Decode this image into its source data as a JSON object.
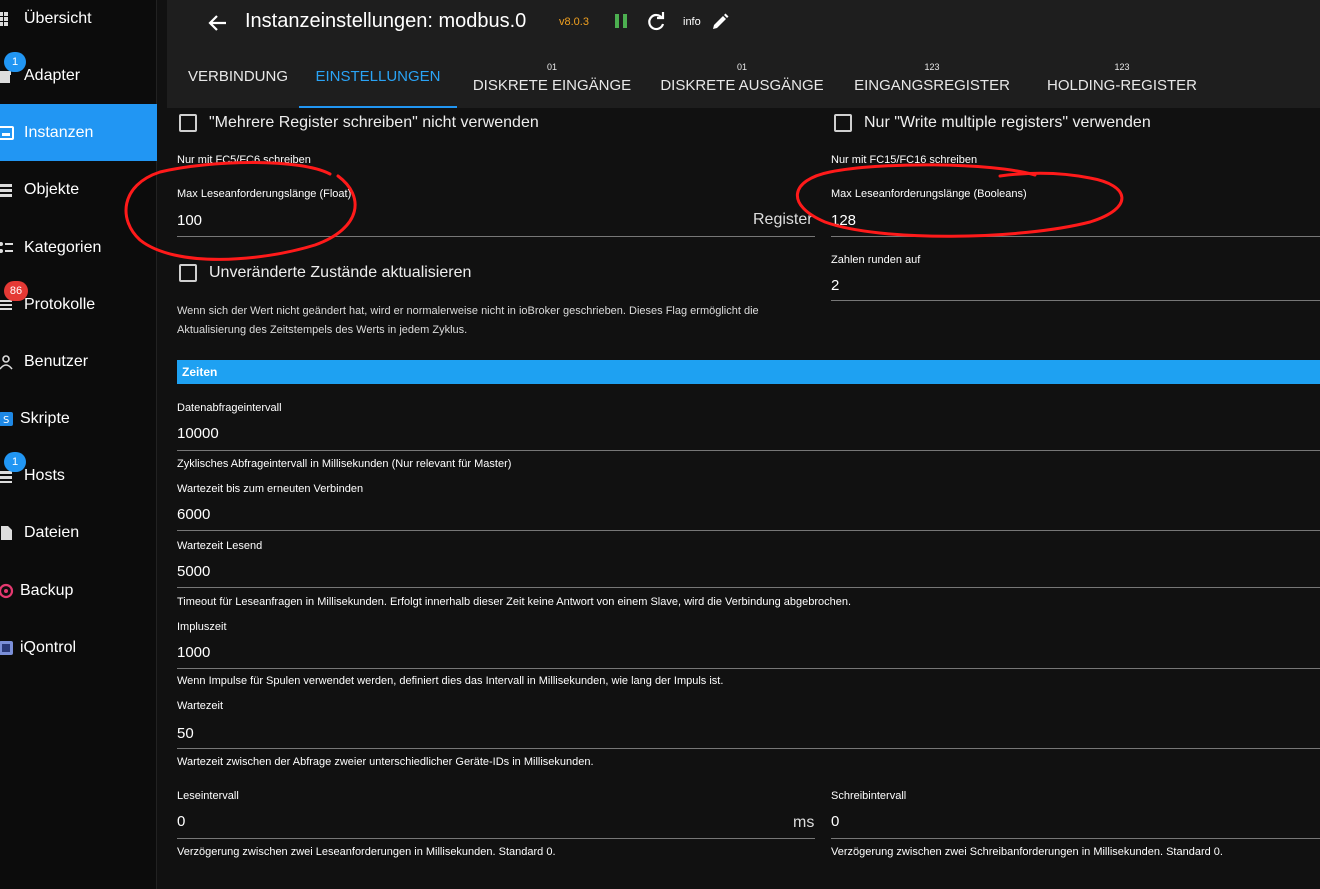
{
  "sidebar": {
    "items": [
      {
        "label": "Übersicht",
        "icon": "grid-icon"
      },
      {
        "label": "Adapter",
        "icon": "store-icon",
        "badge": "1"
      },
      {
        "label": "Instanzen",
        "icon": "instances-icon",
        "active": true
      },
      {
        "label": "Objekte",
        "icon": "list-icon"
      },
      {
        "label": "Kategorien",
        "icon": "categories-icon"
      },
      {
        "label": "Protokolle",
        "icon": "log-icon",
        "badge": "86"
      },
      {
        "label": "Benutzer",
        "icon": "user-icon"
      },
      {
        "label": "Skripte",
        "icon": "script-icon"
      },
      {
        "label": "Hosts",
        "icon": "hosts-icon",
        "badge": "1"
      },
      {
        "label": "Dateien",
        "icon": "file-icon"
      },
      {
        "label": "Backup",
        "icon": "backup-icon"
      },
      {
        "label": "iQontrol",
        "icon": "iqontrol-icon"
      }
    ]
  },
  "header": {
    "title": "Instanzeinstellungen: modbus.0",
    "version": "v8.0.3",
    "info_label": "info"
  },
  "tabs": [
    {
      "label": "VERBINDUNG",
      "sup": ""
    },
    {
      "label": "EINSTELLUNGEN",
      "sup": "",
      "active": true
    },
    {
      "label": "DISKRETE EINGÄNGE",
      "sup": "01"
    },
    {
      "label": "DISKRETE AUSGÄNGE",
      "sup": "01"
    },
    {
      "label": "EINGANGSREGISTER",
      "sup": "123"
    },
    {
      "label": "HOLDING-REGISTER",
      "sup": "123"
    }
  ],
  "settings": {
    "multi_write_checkbox": "\"Mehrere Register schreiben\" nicht verwenden",
    "multi_write_help": "Nur mit FC5/FC6 schreiben",
    "write_multiple_checkbox": "Nur \"Write multiple registers\" verwenden",
    "write_multiple_help": "Nur mit FC15/FC16 schreiben",
    "max_float_label": "Max Leseanforderungslänge (Float)",
    "max_float_value": "100",
    "max_float_unit": "Register",
    "max_bool_label": "Max Leseanforderungslänge (Booleans)",
    "max_bool_value": "128",
    "unchanged_checkbox": "Unveränderte Zustände aktualisieren",
    "unchanged_help": "Wenn sich der Wert nicht geändert hat, wird er normalerweise nicht in ioBroker geschrieben. Dieses Flag ermöglicht die Aktualisierung des Zeitstempels des Werts in jedem Zyklus.",
    "round_label": "Zahlen runden auf",
    "round_value": "2"
  },
  "times": {
    "section_title": "Zeiten",
    "poll_label": "Datenabfrageintervall",
    "poll_value": "10000",
    "poll_help": "Zyklisches Abfrageintervall in Millisekunden (Nur relevant für Master)",
    "reconnect_label": "Wartezeit bis zum erneuten Verbinden",
    "reconnect_value": "6000",
    "read_timeout_label": "Wartezeit Lesend",
    "read_timeout_value": "5000",
    "read_timeout_help": "Timeout für Leseanfragen in Millisekunden. Erfolgt innerhalb dieser Zeit keine Antwort von einem Slave, wird die Verbindung abgebrochen.",
    "pulse_label": "Impluszeit",
    "pulse_value": "1000",
    "pulse_help": "Wenn Impulse für Spulen verwendet werden, definiert dies das Intervall in Millisekunden, wie lang der Impuls ist.",
    "wait_label": "Wartezeit",
    "wait_value": "50",
    "wait_help": "Wartezeit zwischen der Abfrage zweier unterschiedlicher Geräte-IDs in Millisekunden.",
    "read_interval_label": "Leseintervall",
    "read_interval_value": "0",
    "read_interval_unit": "ms",
    "read_interval_help": "Verzögerung zwischen zwei Leseanforderungen in Millisekunden. Standard 0.",
    "write_interval_label": "Schreibintervall",
    "write_interval_value": "0",
    "write_interval_help": "Verzögerung zwischen zwei Schreibanforderungen in Millisekunden. Standard 0."
  },
  "colors": {
    "accent": "#2196f3",
    "badge_blue": "#2196f3",
    "badge_red": "#e53935",
    "annotation": "#ff1a1a",
    "version": "#f0a020",
    "pause": "#4caf50"
  }
}
